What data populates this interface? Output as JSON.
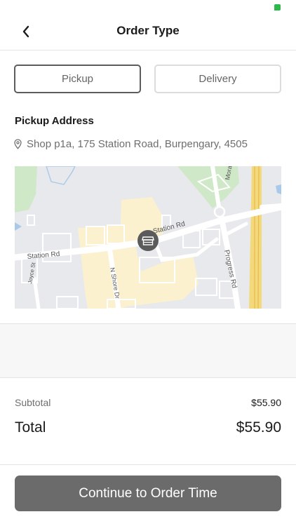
{
  "header": {
    "title": "Order Type"
  },
  "order_type": {
    "pickup_label": "Pickup",
    "delivery_label": "Delivery",
    "selected": "Pickup"
  },
  "pickup": {
    "section_label": "Pickup Address",
    "address": "Shop p1a, 175 Station Road, Burpengary, 4505"
  },
  "map": {
    "street_labels": {
      "station_rd_east": "Station Rd",
      "station_rd_west": "Station Rd",
      "n_shore_dr": "N Shore Dr",
      "progress_rd": "Progress Rd",
      "joyce_st": "Joyce St",
      "mora": "Mora"
    }
  },
  "summary": {
    "subtotal_label": "Subtotal",
    "subtotal_value": "$55.90",
    "total_label": "Total",
    "total_value": "$55.90"
  },
  "cta": {
    "label": "Continue to Order Time"
  },
  "colors": {
    "status_indicator": "#2db84b",
    "cta_background": "#6b6b6b",
    "selected_border": "#5c5c5c",
    "muted_text": "#6e6e6e"
  }
}
